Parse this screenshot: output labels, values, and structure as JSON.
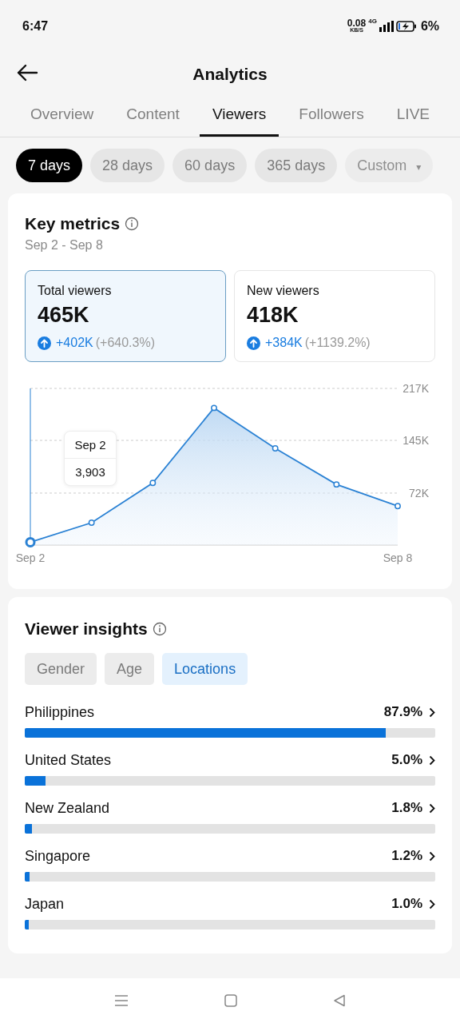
{
  "status_bar": {
    "time": "6:47",
    "speed": "0.08",
    "speed_unit": "KB/S",
    "network": "4G",
    "battery": "6%"
  },
  "header": {
    "title": "Analytics"
  },
  "tabs": [
    {
      "label": "Overview",
      "selected": false
    },
    {
      "label": "Content",
      "selected": false
    },
    {
      "label": "Viewers",
      "selected": true
    },
    {
      "label": "Followers",
      "selected": false
    },
    {
      "label": "LIVE",
      "selected": false
    }
  ],
  "ranges": [
    {
      "label": "7 days",
      "selected": true,
      "disabled": false
    },
    {
      "label": "28 days",
      "selected": false,
      "disabled": false
    },
    {
      "label": "60 days",
      "selected": false,
      "disabled": false
    },
    {
      "label": "365 days",
      "selected": false,
      "disabled": false
    },
    {
      "label": "Custom",
      "caret": "▾",
      "selected": false,
      "disabled": true
    }
  ],
  "key_metrics": {
    "title": "Key metrics",
    "period": "Sep 2 - Sep 8",
    "metrics": [
      {
        "label": "Total viewers",
        "value": "465K",
        "change": "+402K",
        "percent": "(+640.3%)",
        "selected": true
      },
      {
        "label": "New viewers",
        "value": "418K",
        "change": "+384K",
        "percent": "(+1139.2%)",
        "selected": false
      }
    ],
    "tooltip": {
      "date": "Sep 2",
      "value": "3,903"
    },
    "chart_data": {
      "type": "area",
      "categories": [
        "Sep 2",
        null,
        null,
        null,
        null,
        null,
        "Sep 8"
      ],
      "series": [
        {
          "color": "#2b82d4",
          "values": [
            4000,
            31000,
            86000,
            190000,
            134000,
            84000,
            54000
          ]
        }
      ],
      "ylim": [
        0,
        217000
      ],
      "yticks": [
        {
          "value": 72000,
          "label": "72K"
        },
        {
          "value": 145000,
          "label": "145K"
        },
        {
          "value": 217000,
          "label": "217K"
        }
      ]
    }
  },
  "viewer_insights": {
    "title": "Viewer insights",
    "filters": [
      {
        "label": "Gender",
        "selected": false
      },
      {
        "label": "Age",
        "selected": false
      },
      {
        "label": "Locations",
        "selected": true
      }
    ],
    "locations": [
      {
        "name": "Philippines",
        "percent": "87.9%",
        "level": 0.879
      },
      {
        "name": "United States",
        "percent": "5.0%",
        "level": 0.05
      },
      {
        "name": "New Zealand",
        "percent": "1.8%",
        "level": 0.018
      },
      {
        "name": "Singapore",
        "percent": "1.2%",
        "level": 0.012
      },
      {
        "name": "Japan",
        "percent": "1.0%",
        "level": 0.01
      }
    ]
  }
}
